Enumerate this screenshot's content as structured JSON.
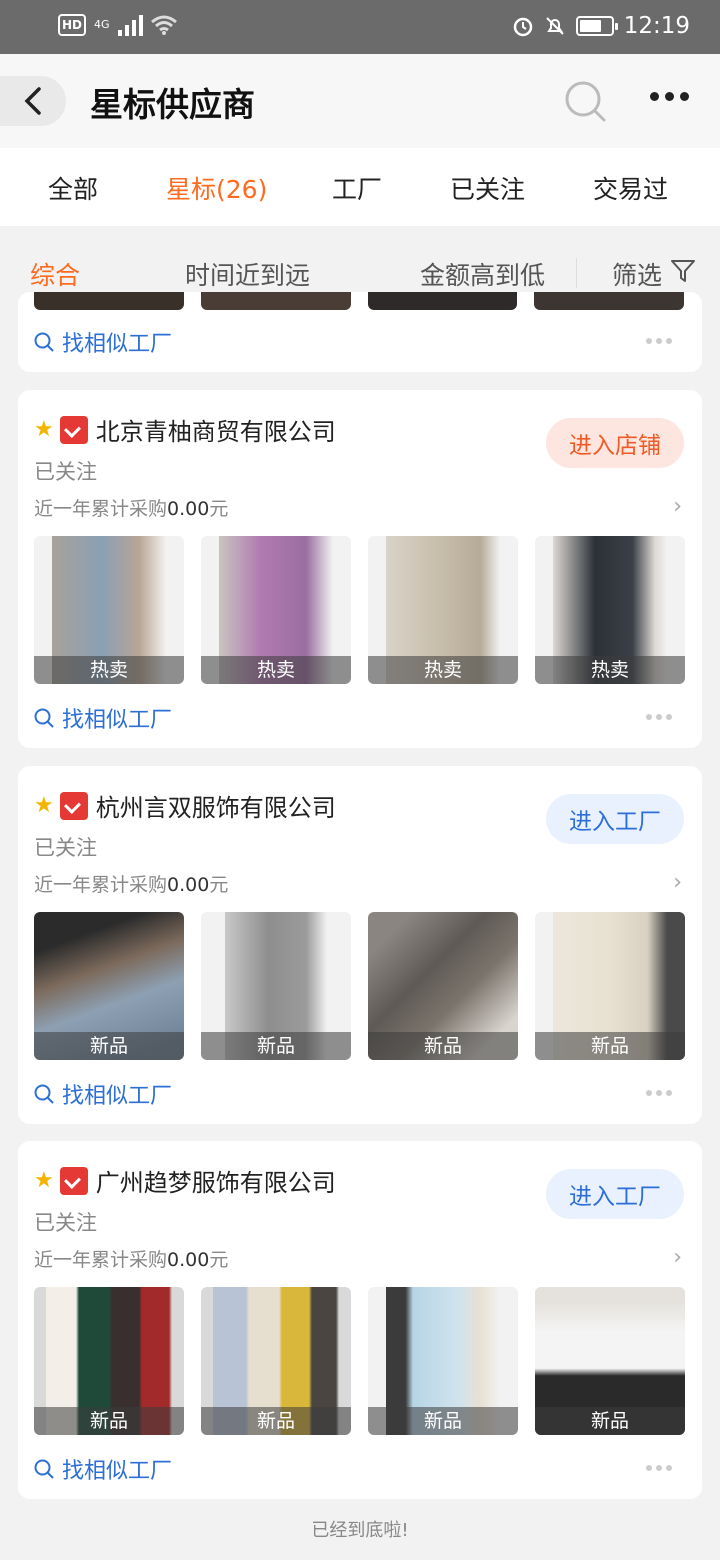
{
  "status_bar": {
    "hd": "HD",
    "network": "4G",
    "time": "12:19"
  },
  "header": {
    "title": "星标供应商"
  },
  "tabs": [
    {
      "label": "全部"
    },
    {
      "label": "星标(26)"
    },
    {
      "label": "工厂"
    },
    {
      "label": "已关注"
    },
    {
      "label": "交易过"
    }
  ],
  "sort": {
    "comprehensive": "综合",
    "time": "时间近到远",
    "amount": "金额高到低",
    "filter": "筛选"
  },
  "find_similar": "找相似工厂",
  "suppliers": [
    {
      "name": "北京青柚商贸有限公司",
      "followed": "已关注",
      "purchase_label": "近一年累计采购",
      "purchase_amount": "0.00",
      "purchase_unit": "元",
      "button": "进入店铺",
      "thumbs": [
        "热卖",
        "热卖",
        "热卖",
        "热卖"
      ]
    },
    {
      "name": "杭州言双服饰有限公司",
      "followed": "已关注",
      "purchase_label": "近一年累计采购",
      "purchase_amount": "0.00",
      "purchase_unit": "元",
      "button": "进入工厂",
      "thumbs": [
        "新品",
        "新品",
        "新品",
        "新品"
      ]
    },
    {
      "name": "广州趋梦服饰有限公司",
      "followed": "已关注",
      "purchase_label": "近一年累计采购",
      "purchase_amount": "0.00",
      "purchase_unit": "元",
      "button": "进入工厂",
      "thumbs": [
        "新品",
        "新品",
        "新品",
        "新品"
      ]
    }
  ],
  "footer": "已经到底啦!",
  "colors": {
    "accent": "#ff6a1f",
    "link": "#2d6fd6"
  }
}
